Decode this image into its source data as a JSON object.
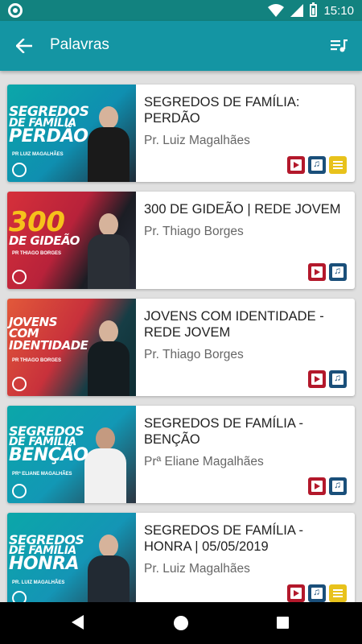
{
  "status_bar": {
    "time": "15:10"
  },
  "app_bar": {
    "title": "Palavras"
  },
  "colors": {
    "status_bar": "#12827f",
    "app_bar": "#1495a3",
    "video": "#b3182b",
    "audio": "#1a4f7a",
    "text": "#e8c21b"
  },
  "items": [
    {
      "title": "SEGREDOS DE FAMÍLIA: PERDÃO",
      "author": "Pr. Luiz Magalhães",
      "thumb": {
        "lines": [
          "SEGREDOS",
          "DE FAMÍLIA",
          "PERDÃO"
        ],
        "sub": "PR LUIZ MAGALHÃES"
      },
      "media": [
        "video",
        "audio",
        "text"
      ]
    },
    {
      "title": "300 DE GIDEÃO | REDE JOVEM",
      "author": "Pr. Thiago Borges",
      "thumb": {
        "lines": [
          "300",
          "DE GIDEÃO"
        ],
        "sub": "PR THIAGO BORGES"
      },
      "media": [
        "video",
        "audio"
      ]
    },
    {
      "title": "JOVENS COM IDENTIDADE - REDE JOVEM",
      "author": "Pr. Thiago Borges",
      "thumb": {
        "lines": [
          "JOVENS",
          "COM",
          "IDENTIDADE"
        ],
        "sub": "PR THIAGO BORGES"
      },
      "media": [
        "video",
        "audio"
      ]
    },
    {
      "title": "SEGREDOS DE FAMÍLIA - BENÇÃO",
      "author": "Prª Eliane Magalhães",
      "thumb": {
        "lines": [
          "SEGREDOS",
          "DE FAMÍLIA",
          "BENÇÃO"
        ],
        "sub": "PRª ELIANE MAGALHÃES"
      },
      "media": [
        "video",
        "audio"
      ]
    },
    {
      "title": "SEGREDOS DE FAMÍLIA - HONRA | 05/05/2019",
      "author": "Pr. Luiz Magalhães",
      "thumb": {
        "lines": [
          "SEGREDOS",
          "DE FAMÍLIA",
          "HONRA"
        ],
        "sub": "PR. LUIZ MAGALHÃES"
      },
      "media": [
        "video",
        "audio",
        "text"
      ]
    }
  ]
}
